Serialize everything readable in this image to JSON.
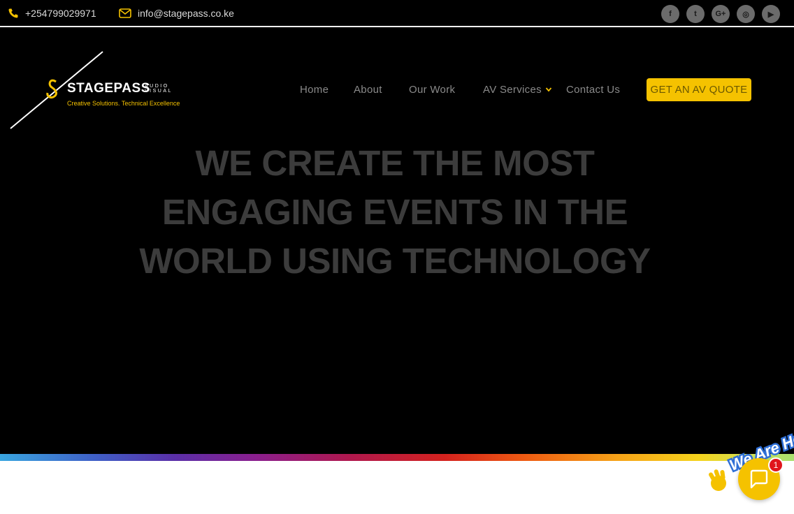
{
  "topbar": {
    "phone": "+254799029971",
    "email": "info@stagepass.co.ke",
    "socials": [
      "facebook-icon",
      "twitter-icon",
      "google-plus-icon",
      "instagram-icon",
      "youtube-icon"
    ],
    "social_glyphs": [
      "f",
      "t",
      "G+",
      "◎",
      "▶"
    ]
  },
  "logo": {
    "name": "STAGEPASS",
    "sub": "AUDIO VISUAL",
    "tagline": "Creative Solutions. Technical Excellence"
  },
  "nav": {
    "items": [
      "Home",
      "About",
      "Our Work",
      "AV Services",
      "Contact Us"
    ],
    "quote_label": "GET AN AV QUOTE"
  },
  "hero": {
    "headline": "WE CREATE THE MOST ENGAGING EVENTS IN THE WORLD USING TECHNOLOGY"
  },
  "chat": {
    "sticker_text": "We Are Here!",
    "badge_count": "1"
  },
  "colors": {
    "accent": "#f5c200",
    "background": "#000000",
    "badge": "#e0151c"
  }
}
